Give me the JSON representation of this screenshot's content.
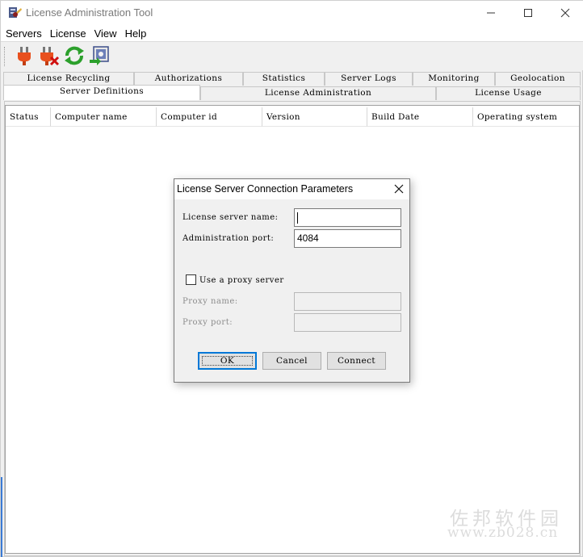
{
  "window": {
    "title": "License Administration Tool",
    "controls": [
      "minimize",
      "maximize",
      "close"
    ]
  },
  "menu": [
    "Servers",
    "License",
    "View",
    "Help"
  ],
  "toolbar": {
    "buttons": [
      {
        "icon": "plug-connect-icon"
      },
      {
        "icon": "plug-disconnect-icon"
      },
      {
        "icon": "refresh-icon"
      },
      {
        "icon": "server-properties-icon"
      }
    ]
  },
  "tabs": {
    "row1": [
      "License Recycling",
      "Authorizations",
      "Statistics",
      "Server Logs",
      "Monitoring",
      "Geolocation"
    ],
    "row2": [
      "Server Definitions",
      "License Administration",
      "License Usage"
    ],
    "active": "Server Definitions"
  },
  "table": {
    "columns": [
      "Status",
      "Computer name",
      "Computer id",
      "Version",
      "Build Date",
      "Operating system"
    ]
  },
  "dialog": {
    "title": "License Server Connection Parameters",
    "server_name_label": "License server name:",
    "server_name_value": "",
    "port_label": "Administration port:",
    "port_value": "4084",
    "proxy_checkbox_label": "Use a proxy server",
    "proxy_checked": false,
    "proxy_name_label": "Proxy name:",
    "proxy_port_label": "Proxy port:",
    "ok_label": "OK",
    "cancel_label": "Cancel",
    "connect_label": "Connect"
  },
  "watermark": {
    "text_cn": "佐邦软件园",
    "url": "www.zb028.cn"
  },
  "colors": {
    "focus_blue": "#0078d7",
    "background": "#f0f0f0"
  }
}
